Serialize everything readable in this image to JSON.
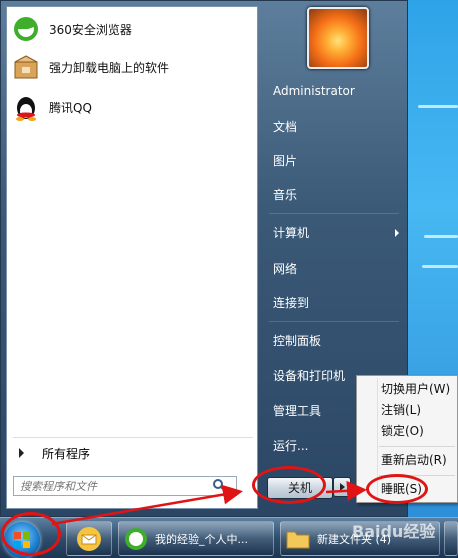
{
  "start_menu": {
    "programs": [
      {
        "label": "360安全浏览器",
        "icon": "browser-360-icon"
      },
      {
        "label": "强力卸载电脑上的软件",
        "icon": "uninstall-box-icon"
      },
      {
        "label": "腾讯QQ",
        "icon": "qq-penguin-icon"
      }
    ],
    "all_programs": "所有程序",
    "search_placeholder": "搜索程序和文件",
    "user_name": "Administrator",
    "right_items": {
      "documents": "文档",
      "pictures": "图片",
      "music": "音乐",
      "computer": "计算机",
      "network": "网络",
      "connect_to": "连接到",
      "control_panel": "控制面板",
      "devices_printers": "设备和打印机",
      "admin_tools": "管理工具",
      "run": "运行..."
    },
    "shutdown_label": "关机"
  },
  "shutdown_menu": {
    "items": [
      "切换用户(W)",
      "注销(L)",
      "锁定(O)",
      "重新启动(R)",
      "睡眠(S)"
    ]
  },
  "taskbar": {
    "buttons": [
      {
        "label": "我的经验_个人中...",
        "icon": "browser-360-icon"
      },
      {
        "label": "新建文件夹 (4)",
        "icon": "folder-icon"
      }
    ]
  },
  "watermark": "Baidu经验",
  "colors": {
    "annotation": "#e01414"
  }
}
